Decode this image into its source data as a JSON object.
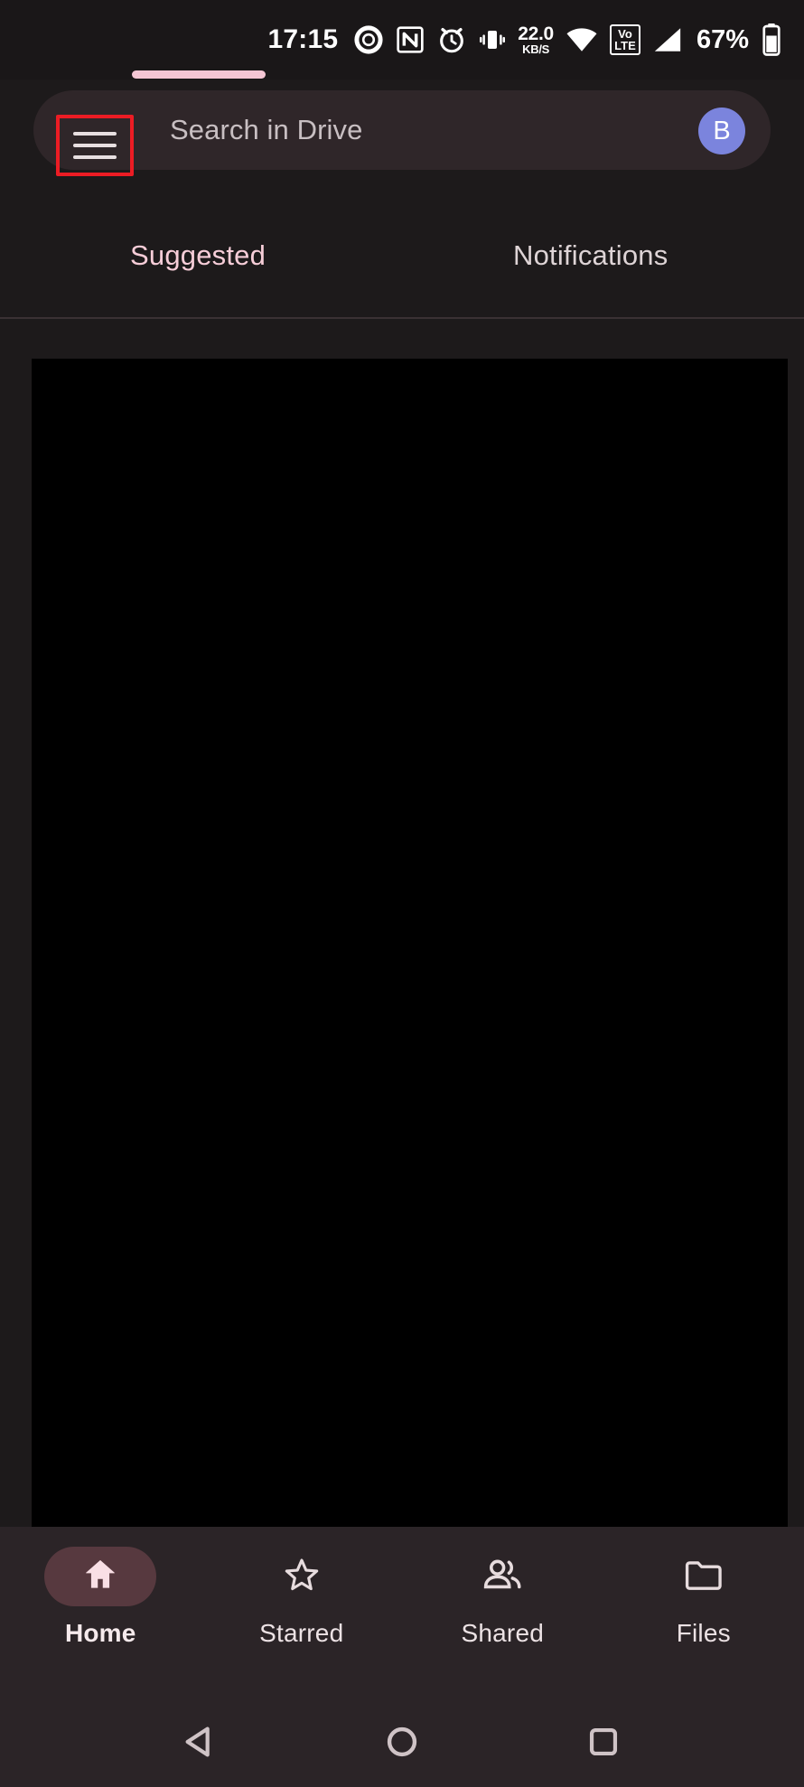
{
  "status_bar": {
    "clock": "17:15",
    "network_speed_value": "22.0",
    "network_speed_unit": "KB/S",
    "volte_line1": "Vo",
    "volte_line2": "LTE",
    "battery_percent": "67%",
    "icons": [
      "screen-record-icon",
      "nfc-icon",
      "alarm-icon",
      "vibrate-icon",
      "wifi-icon",
      "volte-icon",
      "cellular-signal-icon",
      "battery-icon"
    ]
  },
  "header": {
    "menu_icon": "hamburger-menu-icon",
    "search_placeholder": "Search in Drive",
    "avatar_initial": "B",
    "avatar_color": "#7b84dd",
    "highlight_color": "#ec1c24"
  },
  "tabs": [
    {
      "label": "Suggested",
      "active": true
    },
    {
      "label": "Notifications",
      "active": false
    }
  ],
  "tab_accent_color": "#f4c6d4",
  "content": {
    "state": "empty",
    "background_color": "#000000"
  },
  "bottom_nav": [
    {
      "label": "Home",
      "icon": "home-icon",
      "active": true
    },
    {
      "label": "Starred",
      "icon": "star-outline-icon",
      "active": false
    },
    {
      "label": "Shared",
      "icon": "people-icon",
      "active": false
    },
    {
      "label": "Files",
      "icon": "folder-icon",
      "active": false
    }
  ],
  "bottom_nav_active_pill_color": "#57393f",
  "android_nav": [
    {
      "name": "back-button",
      "icon": "triangle-left-icon"
    },
    {
      "name": "home-button",
      "icon": "circle-icon"
    },
    {
      "name": "recents-button",
      "icon": "square-icon"
    }
  ]
}
